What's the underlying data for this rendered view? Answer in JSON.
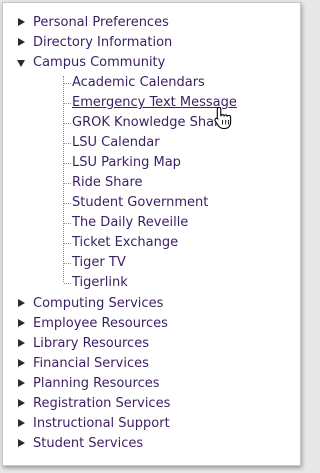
{
  "tree": {
    "top_before": [
      {
        "label": "Personal Preferences"
      },
      {
        "label": "Directory Information"
      }
    ],
    "expanded": {
      "label": "Campus Community",
      "children": [
        {
          "label": "Academic Calendars"
        },
        {
          "label": "Emergency Text Message"
        },
        {
          "label": "GROK Knowledge Shar"
        },
        {
          "label": "LSU Calendar"
        },
        {
          "label": "LSU Parking Map"
        },
        {
          "label": "Ride Share"
        },
        {
          "label": "Student Government"
        },
        {
          "label": "The Daily Reveille"
        },
        {
          "label": "Ticket Exchange"
        },
        {
          "label": "Tiger TV"
        },
        {
          "label": "Tigerlink"
        }
      ]
    },
    "top_after": [
      {
        "label": "Computing Services"
      },
      {
        "label": "Employee Resources"
      },
      {
        "label": "Library Resources"
      },
      {
        "label": "Financial Services"
      },
      {
        "label": "Planning Resources"
      },
      {
        "label": "Registration Services"
      },
      {
        "label": "Instructional Support"
      },
      {
        "label": "Student Services"
      }
    ]
  },
  "colors": {
    "link_text": "#3b1f63",
    "arrow": "#2b2b2b",
    "connector": "#8a8a8a"
  },
  "icons": {
    "collapsed": "caret-right-icon",
    "expanded": "caret-down-icon",
    "pointer": "hand-pointer-cursor-icon"
  }
}
